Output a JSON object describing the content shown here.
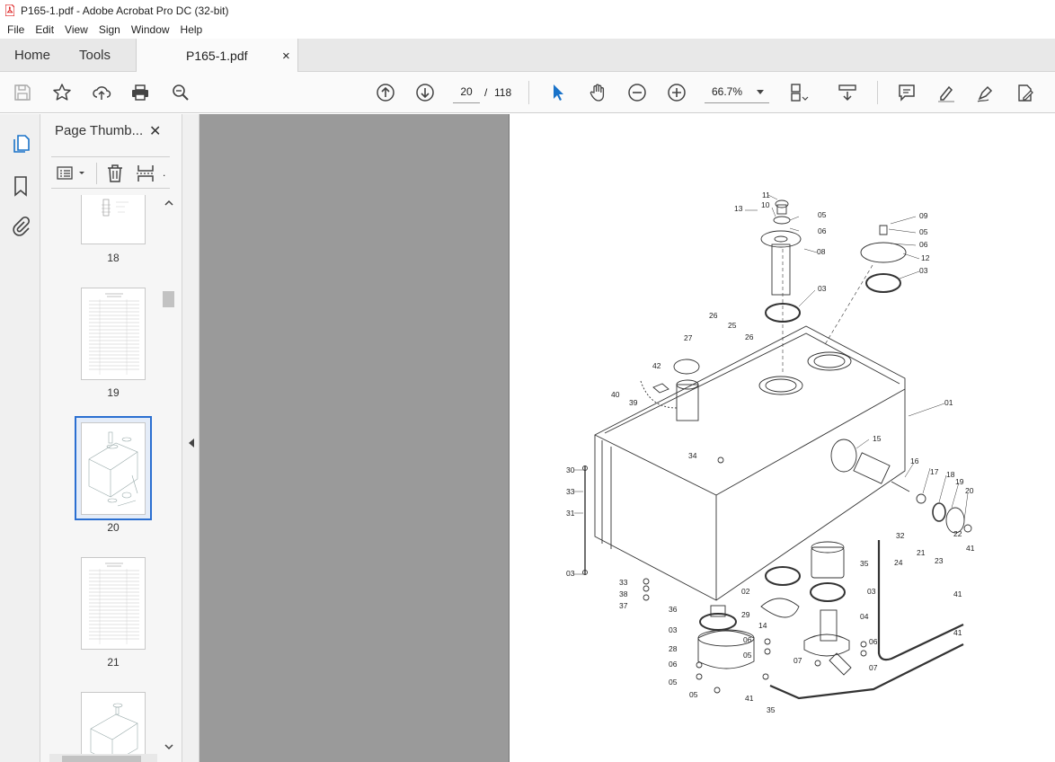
{
  "window": {
    "title": "P165-1.pdf - Adobe Acrobat Pro DC (32-bit)"
  },
  "menu": [
    "File",
    "Edit",
    "View",
    "Sign",
    "Window",
    "Help"
  ],
  "tabs": {
    "home": "Home",
    "tools": "Tools",
    "document": "P165-1.pdf",
    "close_glyph": "×"
  },
  "toolbar": {
    "current_page": "20",
    "page_separator": "/",
    "total_pages": "118",
    "zoom": "66.7%",
    "icons": [
      "save-icon",
      "star-icon",
      "upload-icon",
      "print-icon",
      "search-zoom-icon",
      "page-up-icon",
      "page-down-icon",
      "select-cursor-icon",
      "hand-icon",
      "zoom-out-icon",
      "zoom-in-icon",
      "page-display-icon",
      "scroll-mode-icon",
      "comment-icon",
      "highlight-icon",
      "sign-pen-icon",
      "edit-icon"
    ]
  },
  "sidebar": {
    "panel_title": "Page Thumb...",
    "close_glyph": "✕",
    "thumbnails": [
      {
        "label": "18",
        "selected": false
      },
      {
        "label": "19",
        "selected": false
      },
      {
        "label": "20",
        "selected": true
      },
      {
        "label": "21",
        "selected": false
      },
      {
        "label": "",
        "selected": false
      }
    ]
  },
  "drawing": {
    "callouts": [
      "11",
      "13",
      "10",
      "05",
      "06",
      "08",
      "09",
      "05",
      "06",
      "12",
      "03",
      "03",
      "26",
      "27",
      "25",
      "26",
      "42",
      "40",
      "39",
      "01",
      "34",
      "15",
      "16",
      "17",
      "18",
      "19",
      "20",
      "30",
      "33",
      "31",
      "32",
      "41",
      "22",
      "21",
      "23",
      "24",
      "35",
      "02",
      "03",
      "03",
      "33",
      "38",
      "37",
      "36",
      "29",
      "14",
      "04",
      "06",
      "03",
      "06",
      "05",
      "28",
      "06",
      "05",
      "07",
      "05",
      "07",
      "41",
      "35",
      "41",
      "41"
    ]
  }
}
